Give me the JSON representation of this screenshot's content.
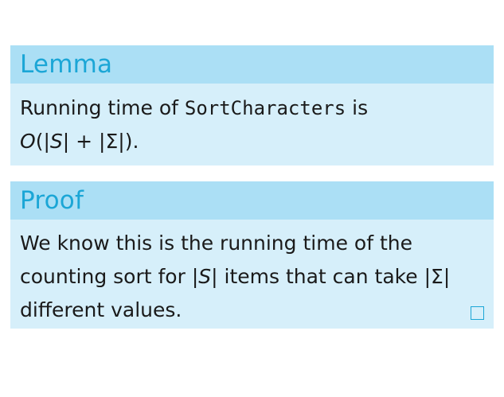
{
  "lemma": {
    "title": "Lemma",
    "text_before": "Running time of ",
    "function_name": "SortCharacters",
    "text_after": " is",
    "formula": {
      "func": "O",
      "open": "(",
      "abs_s_open": "|",
      "s": "S",
      "abs_s_close": "|",
      "plus": " + ",
      "abs_sigma_open": "|",
      "sigma": "Σ",
      "abs_sigma_close": "|",
      "close": ").",
      "close_paren_only": ")"
    }
  },
  "proof": {
    "title": "Proof",
    "line1": "We know this is the running time of the",
    "line2_before": "counting sort for ",
    "line2_s": "S",
    "line2_mid": " items that can take ",
    "line2_sigma": "Σ",
    "line3": "different values.",
    "bar": "|"
  },
  "colors": {
    "header_bg": "#abdff5",
    "header_text": "#1ba6d6",
    "body_bg": "#d6effa"
  }
}
